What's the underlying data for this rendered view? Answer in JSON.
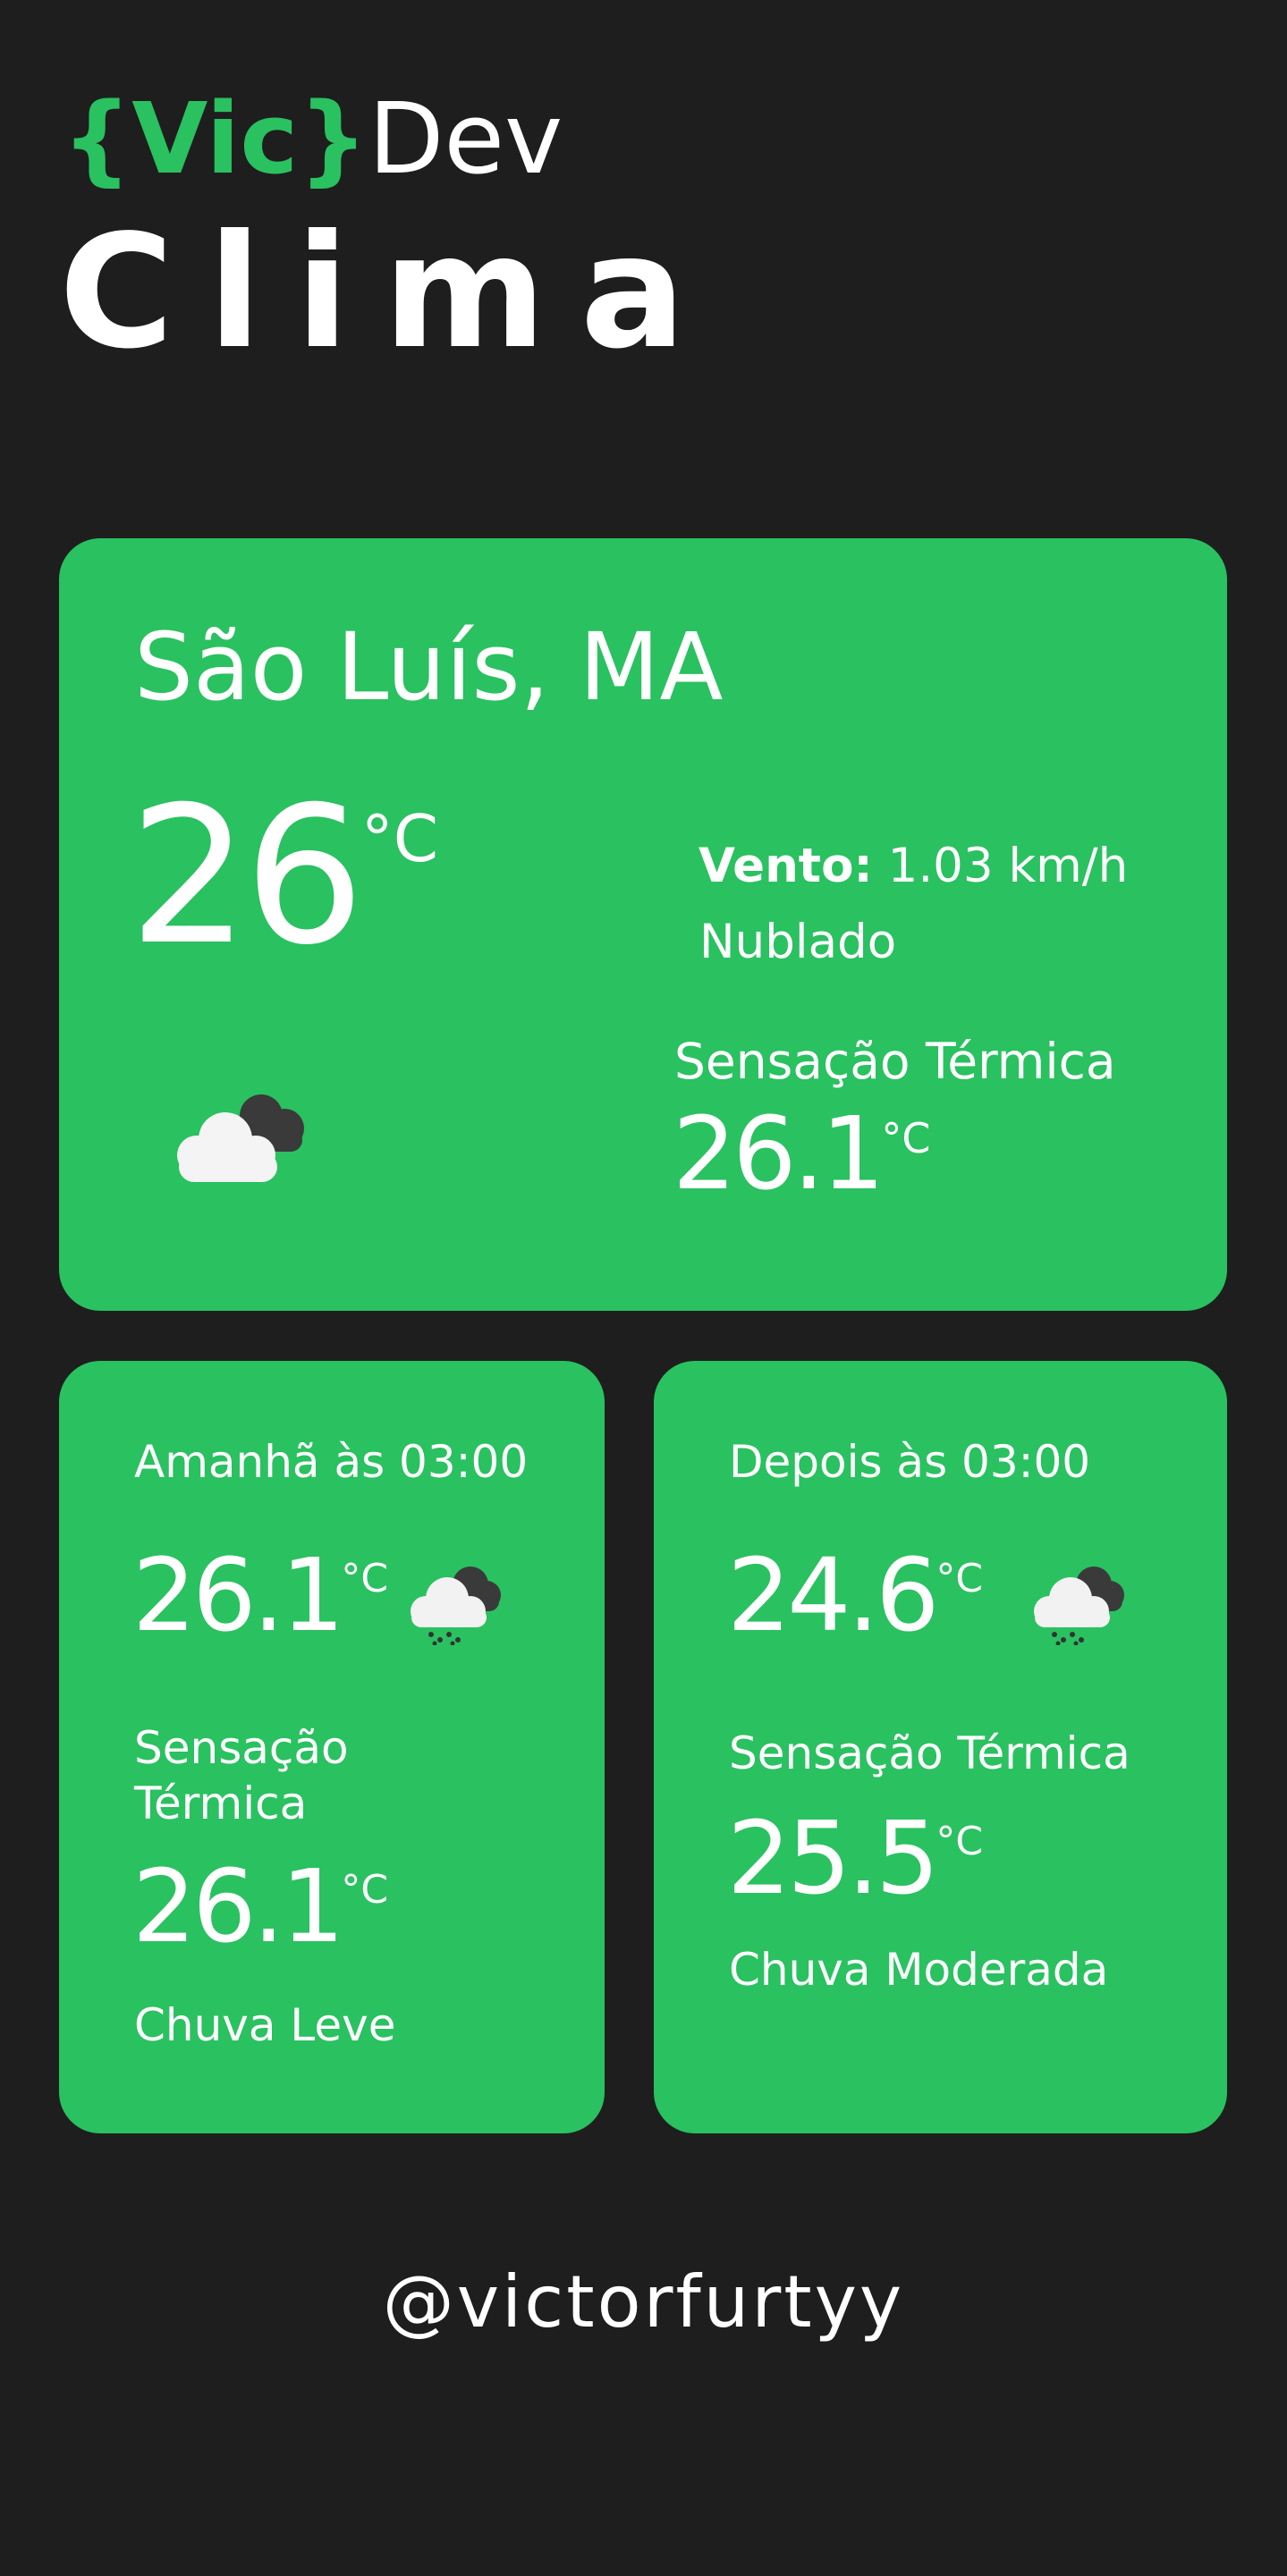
{
  "header": {
    "brand_vic": "{Vic}",
    "brand_dev": "Dev",
    "title": "Clima"
  },
  "current": {
    "city": "São Luís, MA",
    "temperature": "26",
    "unit": "°C",
    "wind_label": "Vento:",
    "wind_value": "1.03 km/h",
    "description": "Nublado",
    "feels_like_label": "Sensação Térmica",
    "feels_like": "26.1",
    "icon": "cloudy-icon"
  },
  "forecast": [
    {
      "when": "Amanhã às 03:00",
      "temperature": "26.1",
      "unit": "°C",
      "feels_like_label": "Sensação Térmica",
      "feels_like": "26.1",
      "description": "Chuva Leve",
      "icon": "rain-cloud-icon"
    },
    {
      "when": "Depois às 03:00",
      "temperature": "24.6",
      "unit": "°C",
      "feels_like_label": "Sensação Térmica",
      "feels_like": "25.5",
      "description": "Chuva Moderada",
      "icon": "rain-cloud-icon"
    }
  ],
  "footer": {
    "handle": "@victorfurtyy"
  },
  "colors": {
    "background": "#1e1e1e",
    "accent": "#2ac160",
    "text": "#ffffff"
  }
}
